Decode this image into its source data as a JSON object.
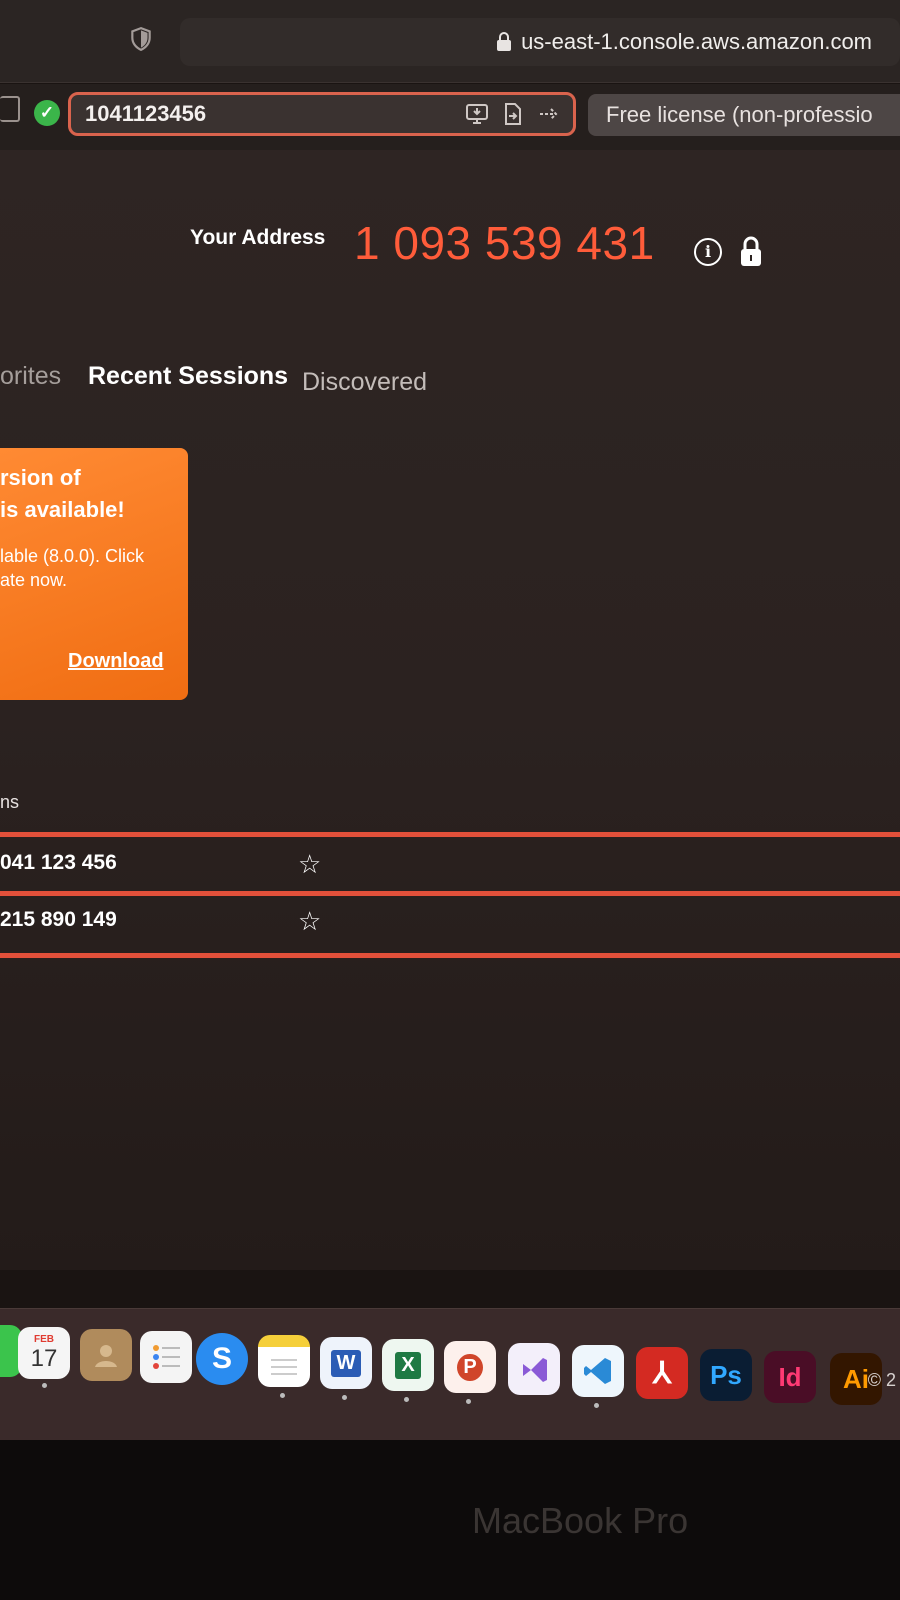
{
  "browser": {
    "url": "us-east-1.console.aws.amazon.com"
  },
  "toolbar": {
    "partner_id": "1041123456",
    "license": "Free license (non-professio"
  },
  "address": {
    "label": "Your Address",
    "value": "1 093 539 431"
  },
  "tabs": [
    {
      "label": "orites"
    },
    {
      "label": "Recent Sessions"
    },
    {
      "label": "Discovered"
    }
  ],
  "update": {
    "title_line1": "rsion of",
    "title_line2": "is available!",
    "body_line1": "lable (8.0.0). Click",
    "body_line2": "ate now.",
    "link": "Download"
  },
  "sessions": {
    "section_label": "ns",
    "rows": [
      {
        "id": "041 123 456"
      },
      {
        "id": "215 890 149"
      }
    ]
  },
  "footer": {
    "copyright": "© 2"
  },
  "dock": {
    "calendar_month": "FEB",
    "calendar_day": "17",
    "items": [
      {
        "icon": "messages-icon"
      },
      {
        "icon": "calendar-icon"
      },
      {
        "icon": "contacts-icon"
      },
      {
        "icon": "reminders-icon"
      },
      {
        "icon": "app-icon"
      },
      {
        "icon": "notes-icon"
      },
      {
        "icon": "word-icon",
        "label": "W"
      },
      {
        "icon": "excel-icon",
        "label": "X"
      },
      {
        "icon": "powerpoint-icon",
        "label": "P"
      },
      {
        "icon": "visual-studio-icon"
      },
      {
        "icon": "vscode-icon"
      },
      {
        "icon": "acrobat-icon"
      },
      {
        "icon": "photoshop-icon",
        "label": "Ps"
      },
      {
        "icon": "indesign-icon",
        "label": "Id"
      },
      {
        "icon": "illustrator-icon",
        "label": "Ai"
      }
    ]
  },
  "device": {
    "label": "MacBook Pro"
  }
}
